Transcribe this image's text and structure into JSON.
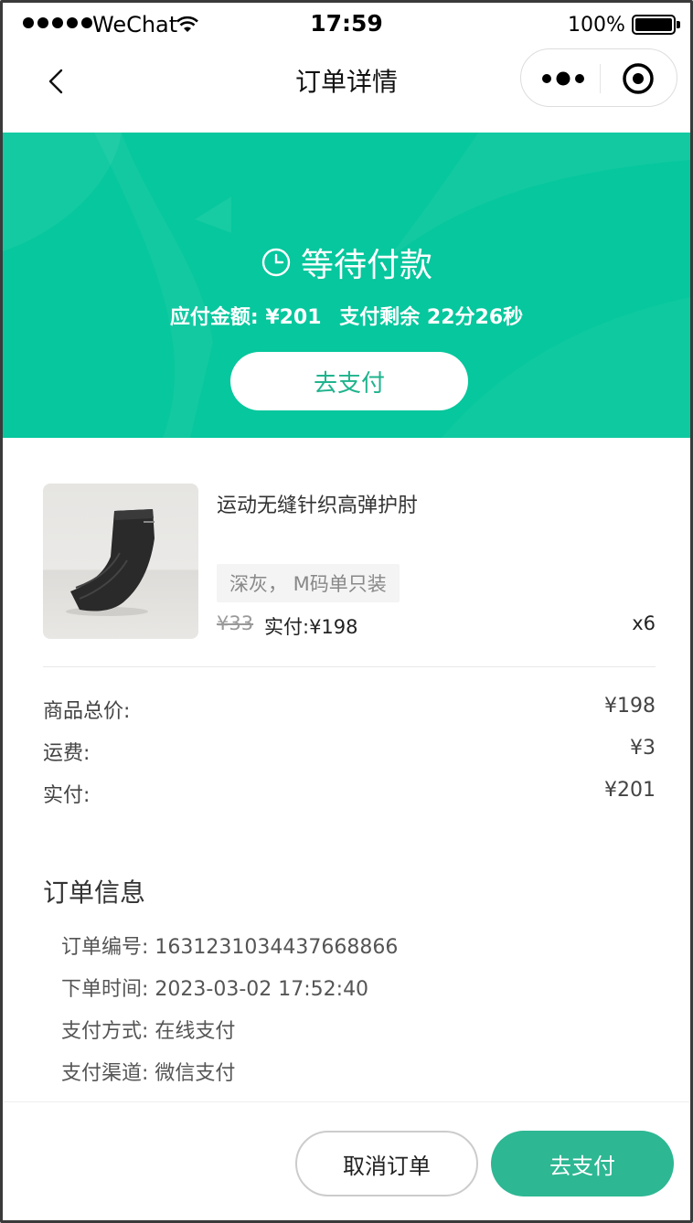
{
  "status_bar": {
    "carrier": "WeChat",
    "time": "17:59",
    "battery": "100%"
  },
  "nav": {
    "title": "订单详情"
  },
  "hero": {
    "status": "等待付款",
    "amount_label": "应付金额: ¥201",
    "remaining_label": "支付剩余 22分26秒",
    "pay_button": "去支付",
    "bg_color": "#06c79d"
  },
  "product": {
    "name": "运动无缝针织高弹护肘",
    "spec": "深灰， M码单只装",
    "original_price": "¥33",
    "paid_price": "实付:¥198",
    "quantity": "x6"
  },
  "summary": [
    {
      "label": "商品总价:",
      "value": "¥198"
    },
    {
      "label": "运费:",
      "value": "¥3"
    },
    {
      "label": "实付:",
      "value": "¥201"
    }
  ],
  "order_info": {
    "title": "订单信息",
    "rows": [
      "订单编号: 1631231034437668866",
      "下单时间: 2023-03-02 17:52:40",
      "支付方式: 在线支付",
      "支付渠道: 微信支付"
    ]
  },
  "actions": {
    "cancel": "取消订单",
    "pay": "去支付",
    "accent_color": "#2db793"
  }
}
